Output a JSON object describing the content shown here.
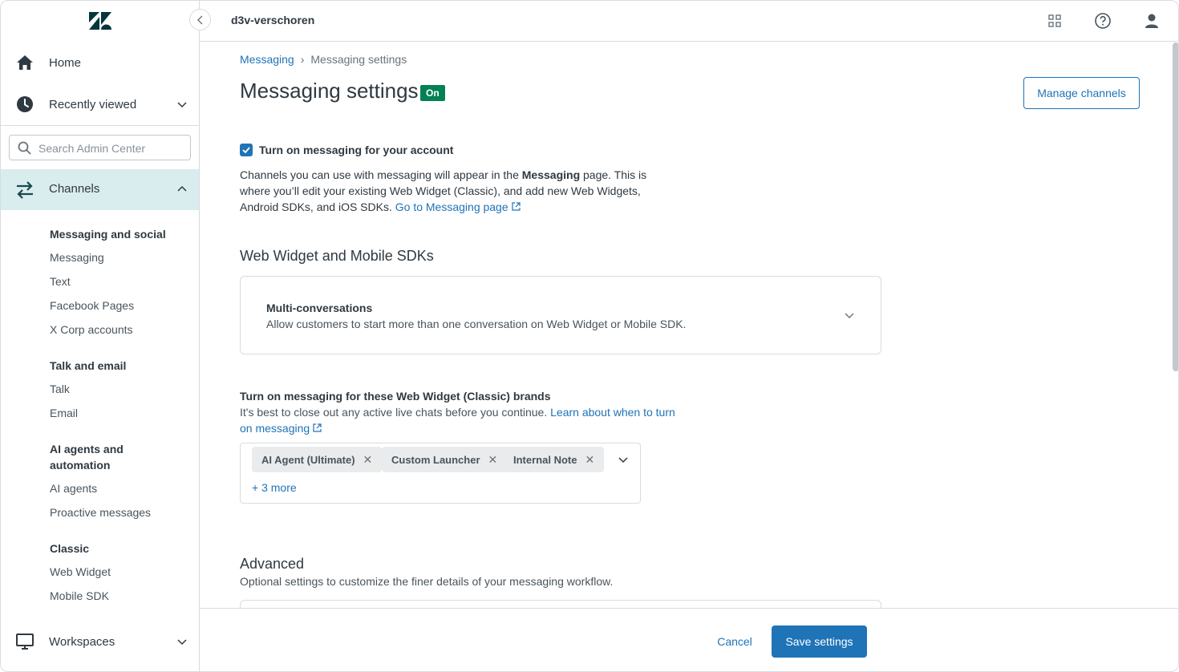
{
  "sidebar": {
    "home": "Home",
    "recently_viewed": "Recently viewed",
    "search_placeholder": "Search Admin Center",
    "channels": "Channels",
    "groups": [
      {
        "heading": "Messaging and social",
        "items": [
          "Messaging",
          "Text",
          "Facebook Pages",
          "X Corp accounts"
        ]
      },
      {
        "heading": "Talk and email",
        "items": [
          "Talk",
          "Email"
        ]
      },
      {
        "heading": "AI agents and automation",
        "items": [
          "AI agents",
          "Proactive messages"
        ]
      },
      {
        "heading": "Classic",
        "items": [
          "Web Widget",
          "Mobile SDK"
        ]
      }
    ],
    "workspaces": "Workspaces"
  },
  "header": {
    "account": "d3v-verschoren"
  },
  "breadcrumb": {
    "parent": "Messaging",
    "separator": "›",
    "current": "Messaging settings"
  },
  "page": {
    "title": "Messaging settings",
    "status_badge": "On",
    "manage_channels": "Manage channels",
    "toggle_label": "Turn on messaging for your account",
    "desc_part1": "Channels you can use with messaging will appear in the ",
    "desc_bold": "Messaging",
    "desc_part2": " page. This is where you’ll edit your existing Web Widget (Classic), and add new Web Widgets, Android SDKs, and iOS SDKs. ",
    "desc_link": "Go to Messaging page",
    "section_web": "Web Widget and Mobile SDKs",
    "multi_title": "Multi-conversations",
    "multi_desc": "Allow customers to start more than one conversation on Web Widget or Mobile SDK.",
    "brands_label": "Turn on messaging for these Web Widget (Classic) brands",
    "brands_hint": "It's best to close out any active live chats before you continue. ",
    "brands_link": "Learn about when to turn on messaging",
    "tags": [
      "AI Agent (Ultimate)",
      "Custom Launcher",
      "Internal Note"
    ],
    "more": "+ 3 more",
    "advanced_title": "Advanced",
    "advanced_desc": "Optional settings to customize the finer details of your messaging workflow."
  },
  "footer": {
    "cancel": "Cancel",
    "save": "Save settings"
  },
  "colors": {
    "accent": "#1f73b7",
    "badge_green": "#038153",
    "nav_active": "#d9ecee"
  }
}
